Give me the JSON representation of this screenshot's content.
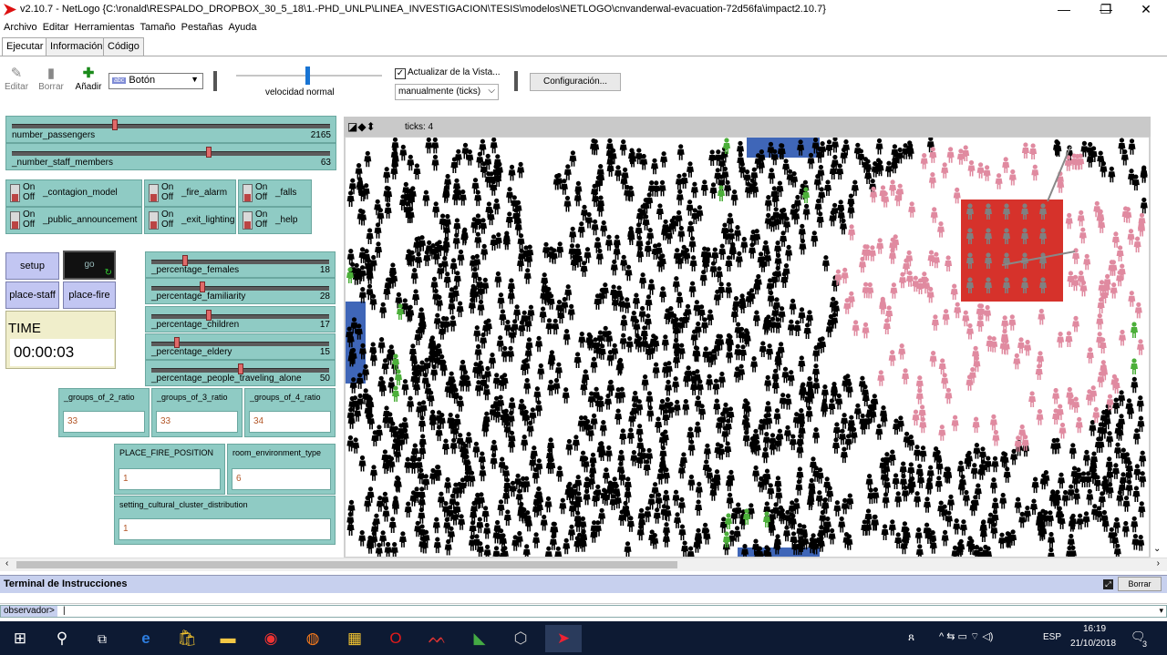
{
  "window": {
    "title": "v2.10.7 - NetLogo {C:\\ronald\\RESPALDO_DROPBOX_30_5_18\\1.-PHD_UNLP\\LINEA_INVESTIGACION\\TESIS\\modelos\\NETLOGO\\cnvanderwal-evacuation-72d56fa\\impact2.10.7}",
    "minimize": "—",
    "restore": "❐",
    "close": "✕"
  },
  "menu": [
    "Archivo",
    "Editar",
    "Herramientas",
    "Tamaño",
    "Pestañas",
    "Ayuda"
  ],
  "tabs": [
    "Ejecutar",
    "Información",
    "Código"
  ],
  "toolbar": {
    "edit": "Editar",
    "delete": "Borrar",
    "add": "Añadir",
    "widget_type": "Botón",
    "widget_icon": "abc",
    "speed_label": "velocidad normal",
    "update_view_label": "Actualizar de la Vista...",
    "update_mode": "manualmente (ticks)",
    "settings": "Configuración..."
  },
  "sliders": [
    {
      "label": "number_passengers",
      "value": "2165",
      "fraction": 0.32
    },
    {
      "label": "_number_staff_members",
      "value": "63",
      "fraction": 0.62
    },
    {
      "label": "_percentage_females",
      "value": "18",
      "fraction": 0.18
    },
    {
      "label": "_percentage_familiarity",
      "value": "28",
      "fraction": 0.28
    },
    {
      "label": "_percentage_children",
      "value": "17",
      "fraction": 0.32
    },
    {
      "label": "_percentage_eldery",
      "value": "15",
      "fraction": 0.13
    },
    {
      "label": "_percentage_people_traveling_alone",
      "value": "50",
      "fraction": 0.5
    }
  ],
  "switches": [
    {
      "label": "_contagion_model",
      "on": "On",
      "off": "Off"
    },
    {
      "label": "_fire_alarm",
      "on": "On",
      "off": "Off"
    },
    {
      "label": "_falls",
      "on": "On",
      "off": "Off"
    },
    {
      "label": "_public_announcement",
      "on": "On",
      "off": "Off"
    },
    {
      "label": "_exit_lighting",
      "on": "On",
      "off": "Off"
    },
    {
      "label": "_help",
      "on": "On",
      "off": "Off"
    }
  ],
  "buttons": {
    "setup": "setup",
    "go": "go",
    "place_staff": "place-staff",
    "place_fire": "place-fire"
  },
  "monitor": {
    "label": "TIME",
    "value": "00:00:03"
  },
  "inputs": [
    {
      "label": "_groups_of_2_ratio",
      "value": "33"
    },
    {
      "label": "_groups_of_3_ratio",
      "value": "33"
    },
    {
      "label": "_groups_of_4_ratio",
      "value": "34"
    },
    {
      "label": "PLACE_FIRE_POSITION",
      "value": "1"
    },
    {
      "label": "room_environment_type",
      "value": "6"
    },
    {
      "label": "setting_cultural_cluster_distribution",
      "value": "1"
    }
  ],
  "view": {
    "ticks_label": "ticks: 4"
  },
  "terminal": {
    "title": "Terminal de Instrucciones",
    "clear": "Borrar",
    "prompt": "observador>"
  },
  "taskbar": {
    "time": "16:19",
    "date": "21/10/2018",
    "lang": "ESP",
    "notifications": "3"
  },
  "colors": {
    "slider_bg": "#8fcbc4",
    "button_bg": "#c2c6f2",
    "monitor_bg": "#f0eecb",
    "fire": "#d6322b",
    "agent_black": "#000000",
    "agent_pink": "#e08aa0",
    "agent_green": "#4caf3a",
    "exit_blue": "#3f66b8",
    "taskbar": "#0d1a33"
  }
}
